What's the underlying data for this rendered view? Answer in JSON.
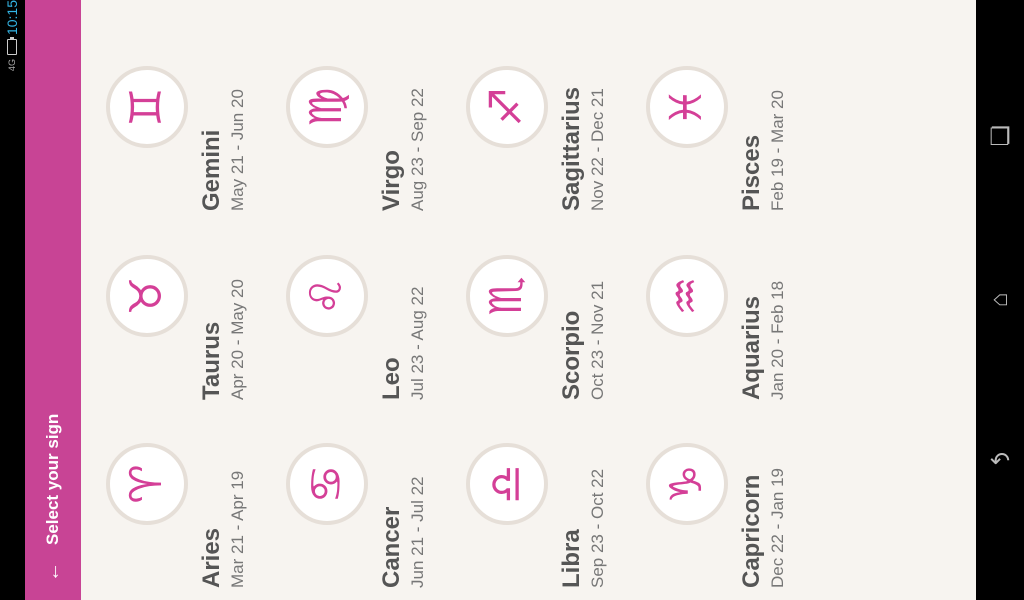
{
  "status_bar": {
    "time": "10:15",
    "network": "4G"
  },
  "app_bar": {
    "title": "Select your sign",
    "back_icon": "arrow-back-icon"
  },
  "signs": [
    {
      "name": "Gemini",
      "dates": "May 21 - Jun 20",
      "glyph": "♊"
    },
    {
      "name": "Virgo",
      "dates": "Aug 23 - Sep 22",
      "glyph": "♍"
    },
    {
      "name": "Sagittarius",
      "dates": "Nov 22 - Dec 21",
      "glyph": "♐"
    },
    {
      "name": "Pisces",
      "dates": "Feb 19 - Mar 20",
      "glyph": "♓"
    },
    {
      "name": "Taurus",
      "dates": "Apr 20 - May 20",
      "glyph": "♉"
    },
    {
      "name": "Leo",
      "dates": "Jul 23 - Aug 22",
      "glyph": "♌"
    },
    {
      "name": "Scorpio",
      "dates": "Oct 23 - Nov 21",
      "glyph": "♏"
    },
    {
      "name": "Aquarius",
      "dates": "Jan 20 - Feb 18",
      "glyph": "♒"
    },
    {
      "name": "Aries",
      "dates": "Mar 21 - Apr 19",
      "glyph": "♈"
    },
    {
      "name": "Cancer",
      "dates": "Jun 21 - Jul 22",
      "glyph": "♋"
    },
    {
      "name": "Libra",
      "dates": "Sep 23 - Oct 22",
      "glyph": "♎"
    },
    {
      "name": "Capricorn",
      "dates": "Dec 22 - Jan 19",
      "glyph": "♑"
    }
  ],
  "nav": {
    "recents_icon": "recents-icon",
    "home_icon": "home-icon",
    "back_icon": "back-icon"
  },
  "colors": {
    "accent": "#c84495",
    "glyph": "#d43f97",
    "background": "#f7f4f0"
  }
}
